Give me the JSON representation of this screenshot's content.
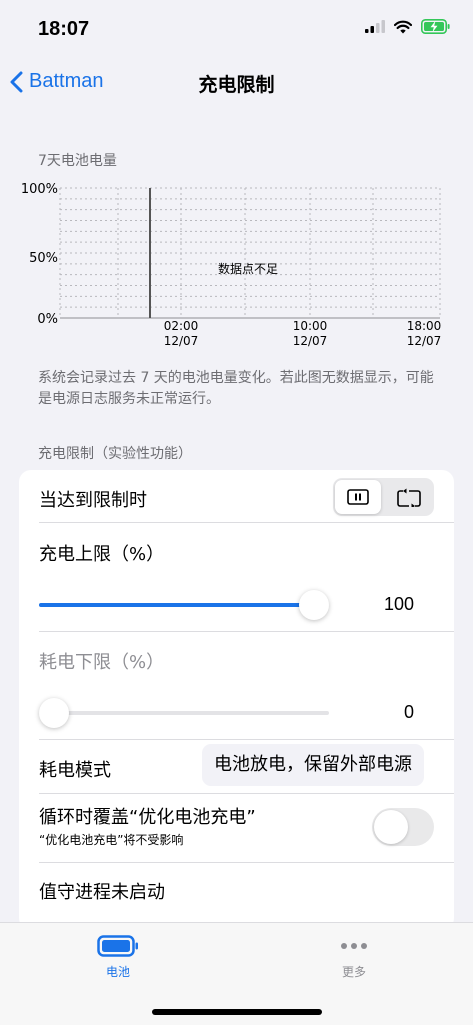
{
  "status_bar": {
    "time": "18:07"
  },
  "nav": {
    "back_label": "Battman",
    "title": "充电限制"
  },
  "chart_section": {
    "title": "7天电池电量",
    "footnote": "系统会记录过去 7 天的电池电量变化。若此图无数据显示，可能是电源日志服务未正常运行。"
  },
  "chart_data": {
    "type": "line",
    "y_ticks": [
      "100%",
      "50%",
      "0%"
    ],
    "ylim": [
      0,
      100
    ],
    "x_ticks": [
      {
        "time": "02:00",
        "date": "12/07"
      },
      {
        "time": "10:00",
        "date": "12/07"
      },
      {
        "time": "18:00",
        "date": "12/07"
      }
    ],
    "series": [],
    "empty_message": "数据点不足",
    "grid": true
  },
  "limit_section": {
    "title": "充电限制（实验性功能）"
  },
  "card": {
    "on_limit_label": "当达到限制时",
    "on_limit_selected": "pause",
    "charge_upper_label": "充电上限（%）",
    "charge_upper_value": 100,
    "charge_upper_display": "100",
    "discharge_lower_label": "耗电下限（%）",
    "discharge_lower_value": 0,
    "discharge_lower_display": "0",
    "drain_mode_label": "耗电模式",
    "drain_mode_value": "电池放电，保留外部电源",
    "cycle_override_label": "循环时覆盖“优化电池充电”",
    "cycle_override_sub": "“优化电池充电”将不受影响",
    "cycle_override_on": false,
    "daemon_status": "值守进程未启动"
  },
  "tabbar": {
    "tabs": [
      {
        "label": "电池",
        "active": true
      },
      {
        "label": "更多",
        "active": false
      }
    ]
  },
  "colors": {
    "accent": "#1a73e8",
    "battery_green": "#34c759"
  }
}
